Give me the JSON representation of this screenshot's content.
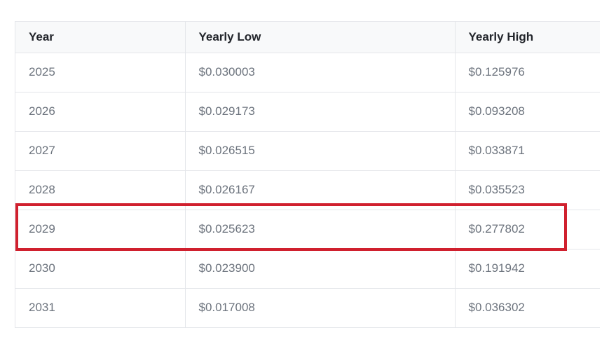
{
  "table": {
    "headers": [
      "Year",
      "Yearly Low",
      "Yearly High"
    ],
    "rows": [
      {
        "year": "2025",
        "low": "$0.030003",
        "high": "$0.125976"
      },
      {
        "year": "2026",
        "low": "$0.029173",
        "high": "$0.093208"
      },
      {
        "year": "2027",
        "low": "$0.026515",
        "high": "$0.033871"
      },
      {
        "year": "2028",
        "low": "$0.026167",
        "high": "$0.035523"
      },
      {
        "year": "2029",
        "low": "$0.025623",
        "high": "$0.277802"
      },
      {
        "year": "2030",
        "low": "$0.023900",
        "high": "$0.191942"
      },
      {
        "year": "2031",
        "low": "$0.017008",
        "high": "$0.036302"
      }
    ]
  },
  "highlight": {
    "row_year": "2029",
    "color": "#d0202e"
  },
  "colors": {
    "header_bg": "#f8f9fa",
    "border": "#e4e6ea",
    "header_text": "#22252b",
    "cell_text": "#6c737d"
  }
}
